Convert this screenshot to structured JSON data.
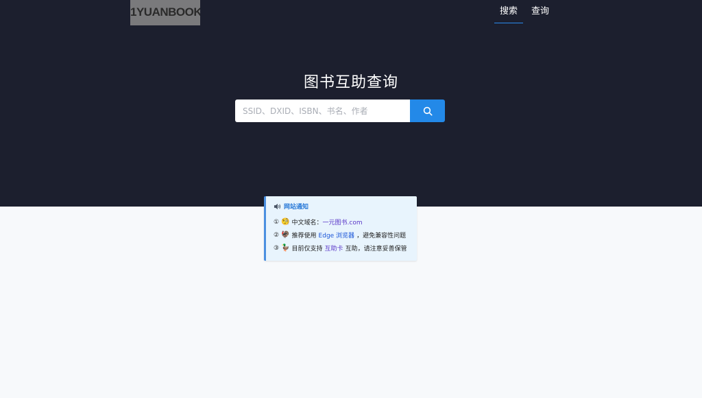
{
  "header": {
    "logo_text": "1YUANBOOK",
    "nav": [
      {
        "label": "搜索",
        "active": true
      },
      {
        "label": "查询",
        "active": false
      }
    ]
  },
  "hero": {
    "title": "图书互助查询",
    "search": {
      "placeholder": "SSID、DXID、ISBN、书名、作者",
      "value": "",
      "button_icon": "search-icon"
    }
  },
  "notice": {
    "title_icon": "speaker-icon",
    "title": "网站通知",
    "items": [
      {
        "num": "①",
        "emoji": "🧐",
        "text_before": "中文域名：",
        "link": "一元图书.com",
        "text_after": ""
      },
      {
        "num": "②",
        "emoji": "🦃",
        "text_before": "推荐使用",
        "link": "Edge 浏览器",
        "text_after": "，避免兼容性问题"
      },
      {
        "num": "③",
        "emoji": "🦆",
        "text_before": "目前仅支持",
        "link": "互助卡",
        "text_after": "互助，请注意妥善保管"
      }
    ]
  },
  "colors": {
    "hero_bg": "#1c1f2e",
    "page_bg": "#f7f9fb",
    "accent": "#2389e8",
    "notice_bg": "#e8f4fd",
    "link": "#5a36c8"
  }
}
